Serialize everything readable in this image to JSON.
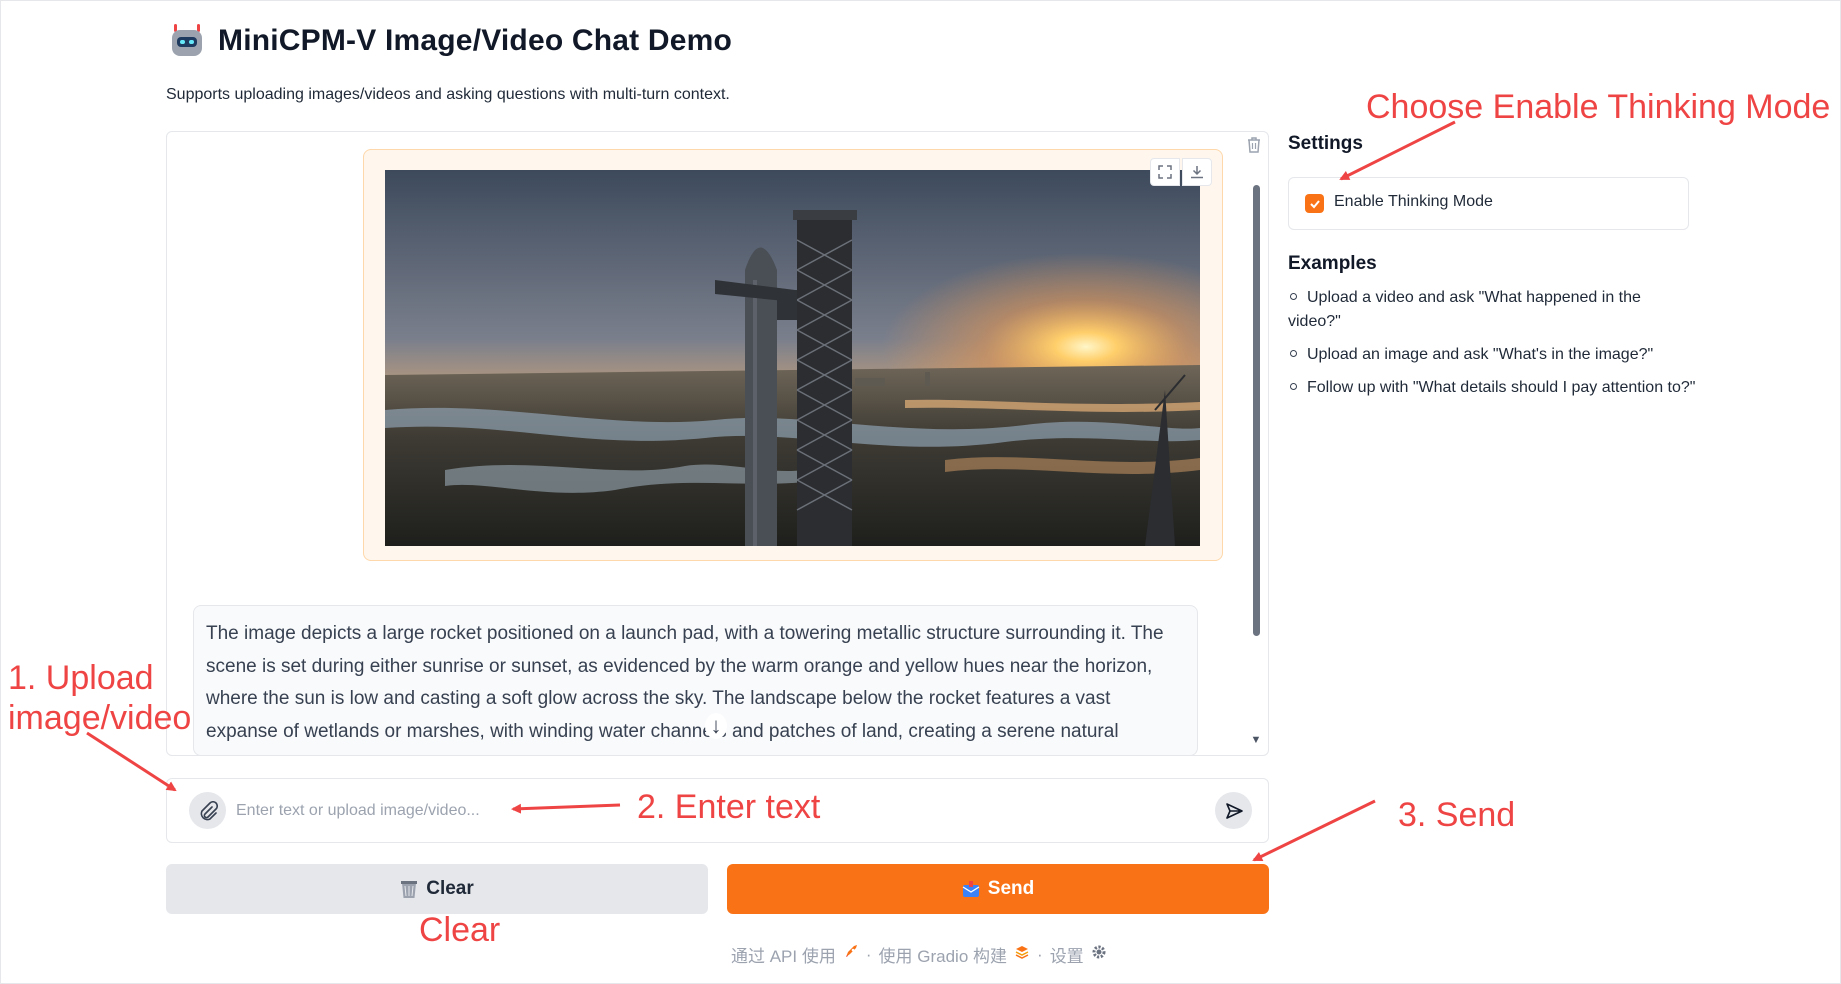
{
  "header": {
    "title": "MiniCPM-V Image/Video Chat Demo",
    "subtitle": "Supports uploading images/videos and asking questions with multi-turn context.",
    "logo_icon": "robot-icon"
  },
  "chat": {
    "response_text": "The image depicts a large rocket positioned on a launch pad, with a towering metallic structure surrounding it. The scene is set during either sunrise or sunset, as evidenced by the warm orange and yellow hues near the horizon, where the sun is low and casting a soft glow across the sky. The landscape below the rocket features a vast expanse of wetlands or marshes, with winding water channels and patches of land, creating a serene natural backdrop. In the distance, other structures and industrial elements are visible, adding a sense of human activity to the"
  },
  "input": {
    "placeholder": "Enter text or upload image/video..."
  },
  "buttons": {
    "clear_label": "Clear",
    "send_label": "Send"
  },
  "footer": {
    "api_label": "通过 API 使用",
    "gradio_label": "使用 Gradio 构建",
    "settings_label": "设置"
  },
  "settings": {
    "title": "Settings",
    "thinking_label": "Enable Thinking Mode",
    "thinking_checked": true
  },
  "examples": {
    "title": "Examples",
    "items": [
      "Upload a video and ask \"What happened in the video?\"",
      "Upload an image and ask \"What's in the image?\"",
      "Follow up with \"What details should I pay attention to?\""
    ]
  },
  "annotations": {
    "thinking": "Choose Enable Thinking Mode",
    "upload_line1": "1. Upload",
    "upload_line2": "image/video",
    "enter_text": "2. Enter text",
    "send": "3. Send",
    "clear": "Clear"
  },
  "colors": {
    "accent": "#f97316",
    "annotation": "#ef4444"
  }
}
